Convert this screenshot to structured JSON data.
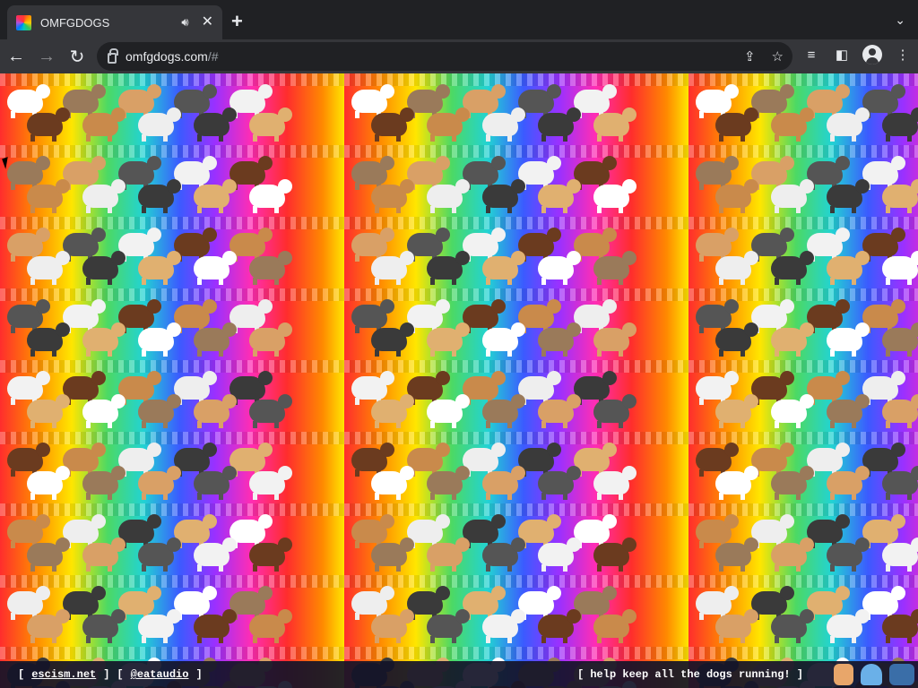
{
  "browser": {
    "tab": {
      "title": "OMFGDOGS",
      "audio_icon": "speaker-icon",
      "close_icon": "close-icon"
    },
    "new_tab_icon": "plus-icon",
    "tab_search_icon": "chevron-down-icon",
    "toolbar": {
      "back_icon": "arrow-left-icon",
      "forward_icon": "arrow-right-icon",
      "reload_icon": "reload-icon",
      "url_host": "omfgdogs.com",
      "url_rest": "/#",
      "share_icon": "share-icon",
      "bookmark_icon": "star-icon",
      "media_icon": "media-control-icon",
      "sidepanel_icon": "side-panel-icon",
      "profile_icon": "profile-icon",
      "menu_icon": "kebab-menu-icon"
    }
  },
  "page": {
    "background_colors": [
      "#ff2d2d",
      "#ff8a00",
      "#ffe600",
      "#4cd964",
      "#22d3d3",
      "#3b5bff",
      "#9b30ff",
      "#ff2db4"
    ],
    "footer": {
      "open_bracket_1": "[",
      "link_1": "escism.net",
      "close_bracket_1": "]",
      "open_bracket_2": "[",
      "link_2": "@eataudio",
      "close_bracket_2": "]",
      "message": "[ help keep all the dogs running! ]"
    }
  }
}
